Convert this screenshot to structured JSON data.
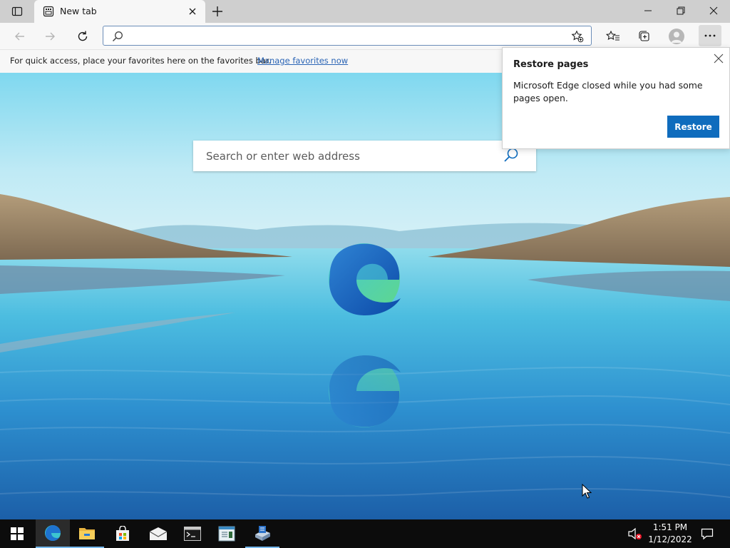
{
  "browser": {
    "tab": {
      "title": "New tab"
    },
    "omnibox": {
      "value": "",
      "placeholder": ""
    }
  },
  "favorites_bar": {
    "message": "For quick access, place your favorites here on the favorites bar.",
    "link": "Manage favorites now"
  },
  "new_tab_page": {
    "search_placeholder": "Search or enter web address"
  },
  "restore_popup": {
    "title": "Restore pages",
    "message": "Microsoft Edge closed while you had some pages open.",
    "button": "Restore"
  },
  "taskbar": {
    "time": "1:51 PM",
    "date": "1/12/2022",
    "apps": [
      "edge-icon",
      "file-explorer-icon",
      "store-icon",
      "mail-icon",
      "terminal-icon",
      "notepad-icon",
      "server-manager-icon"
    ]
  },
  "colors": {
    "accent": "#0f6cbd",
    "link": "#2a64b5",
    "taskbar": "#0c0c0c"
  }
}
